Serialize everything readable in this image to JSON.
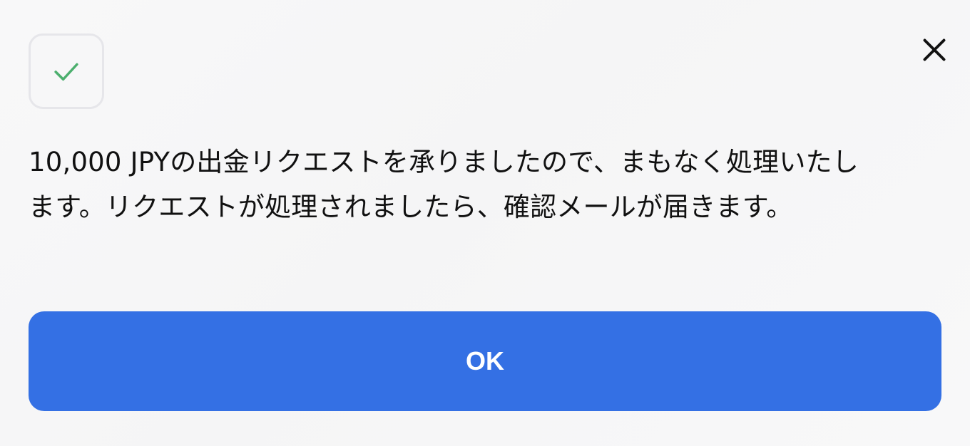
{
  "dialog": {
    "status_icon": "check-icon",
    "close_icon": "close-icon",
    "message_line1": "10,000 JPYの出金リクエストを承りましたので、まもなく処理いたし",
    "message_line2": "ます。リクエストが処理されましたら、確認メールが届きます。",
    "ok_label": "OK"
  },
  "colors": {
    "accent": "#3470e4",
    "success": "#4caf6e",
    "text": "#111111"
  }
}
